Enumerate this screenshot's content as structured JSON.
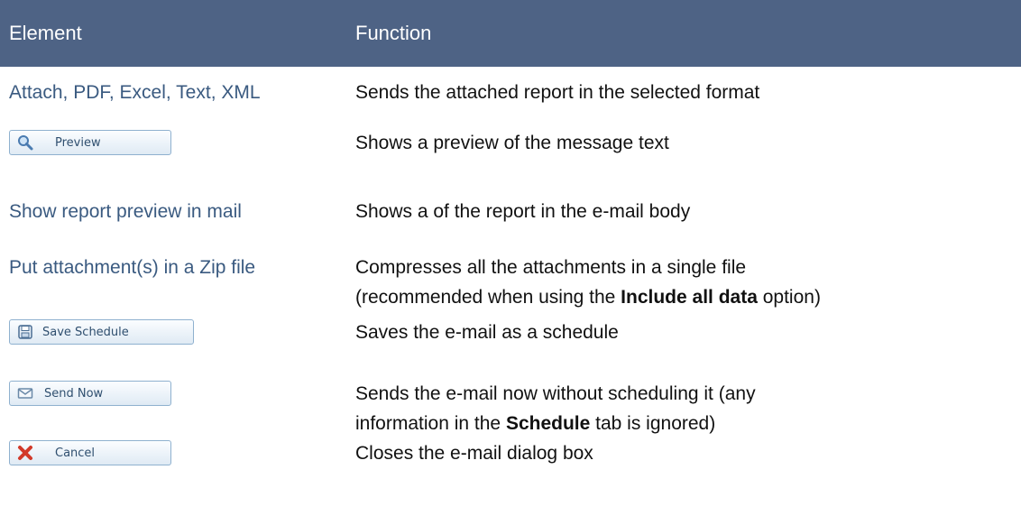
{
  "header": {
    "element": "Element",
    "function": "Function"
  },
  "rows": [
    {
      "element": "Attach, PDF, Excel, Text, XML",
      "function": "Sends the attached report in the selected format"
    },
    {
      "button_label": "Preview",
      "button_icon": "magnifier-icon",
      "function": "Shows a preview of the message text"
    },
    {
      "element": "Show report preview in mail",
      "function": "Shows a of the report in the e-mail body"
    },
    {
      "element": "Put attachment(s) in a Zip file",
      "function_line1": "Compresses all the attachments in a single file",
      "function_line2_before": "(recommended when using the ",
      "function_line2_bold": "Include all data",
      "function_line2_after": " option)"
    },
    {
      "button_label": "Save Schedule",
      "button_icon": "floppy-disk-icon",
      "function": "Saves the e-mail as a schedule"
    },
    {
      "button_label": "Send Now",
      "button_icon": "envelope-icon",
      "function_line1": "Sends the e-mail now without scheduling it (any",
      "function_line2_before": "information in the ",
      "function_line2_bold": "Schedule",
      "function_line2_after": " tab is ignored)"
    },
    {
      "button_label": "Cancel",
      "button_icon": "red-x-icon",
      "function": "Closes the e-mail dialog box"
    }
  ],
  "colors": {
    "header_bg": "#4e6385",
    "header_text": "#ffffff",
    "element_text": "#3a5a80",
    "button_border": "#8fb1cf",
    "cancel_icon": "#d23a2a"
  }
}
